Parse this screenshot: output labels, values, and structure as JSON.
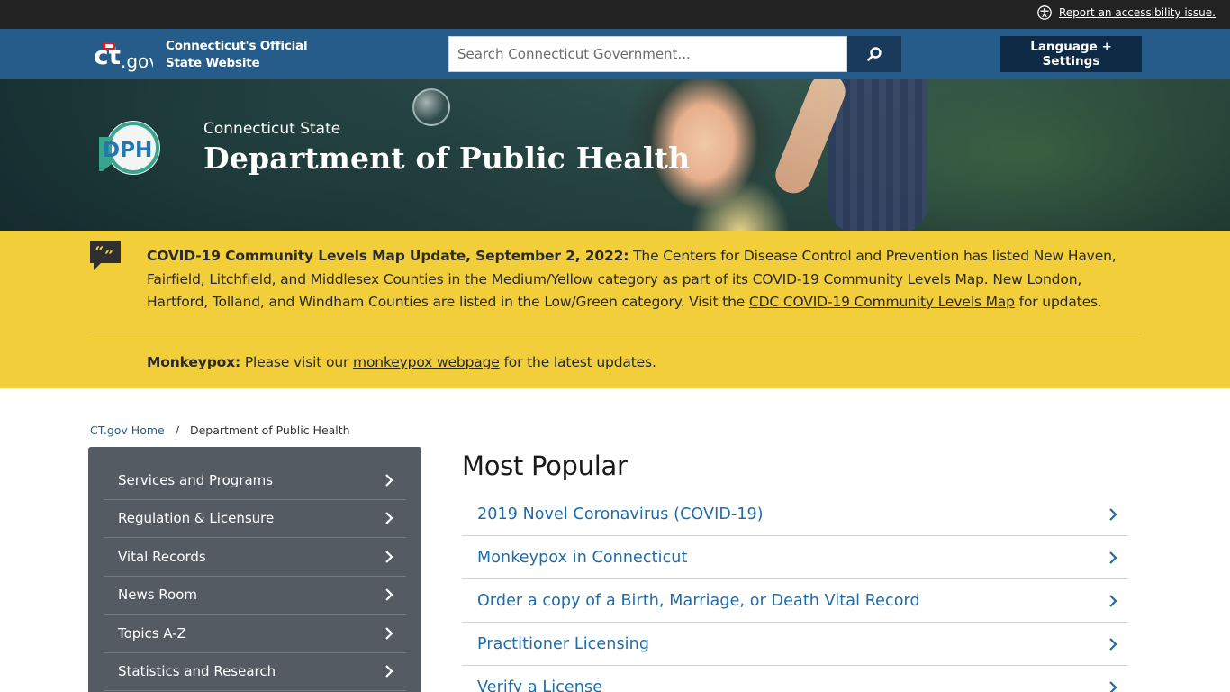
{
  "utility": {
    "a11y_label": "Report an accessibility issue."
  },
  "header": {
    "logo_text": "ct.gov",
    "official_line1": "Connecticut's Official",
    "official_line2": "State Website",
    "search_placeholder": "Search Connecticut Government...",
    "language_button": "Language + Settings",
    "header_color": "#255c8a"
  },
  "hero": {
    "logo_text": "DPH",
    "subtitle": "Connecticut State",
    "title": "Department of Public Health"
  },
  "alert": {
    "bg_color": "#f2ce3a",
    "item1_bold": "COVID-19 Community Levels Map Update, September 2, 2022:",
    "item1_text": " The Centers for Disease Control and Prevention has listed New Haven, Fairfield, Litchfield, and Middlesex Counties in the Medium/Yellow category as part of its COVID-19 Community Levels Map. New London, Hartford, Tolland, and Windham Counties are listed in the Low/Green category. Visit the ",
    "item1_link": "CDC COVID-19 Community Levels Map",
    "item1_tail": " for updates.",
    "item2_bold": "Monkeypox:",
    "item2_text": " Please visit our ",
    "item2_link": "monkeypox webpage",
    "item2_tail": " for the latest updates."
  },
  "breadcrumb": {
    "home": "CT.gov Home",
    "separator": "/",
    "current": "Department of Public Health"
  },
  "side_nav": {
    "items": [
      {
        "label": "Services and Programs"
      },
      {
        "label": "Regulation & Licensure"
      },
      {
        "label": "Vital Records"
      },
      {
        "label": "News Room"
      },
      {
        "label": "Topics A-Z"
      },
      {
        "label": "Statistics and Research"
      }
    ]
  },
  "most_popular": {
    "title": "Most Popular",
    "items": [
      {
        "label": "2019 Novel Coronavirus (COVID-19)"
      },
      {
        "label": "Monkeypox in Connecticut"
      },
      {
        "label": "Order a copy of a Birth, Marriage, or Death Vital Record"
      },
      {
        "label": "Practitioner Licensing"
      },
      {
        "label": "Verify a License"
      }
    ]
  }
}
